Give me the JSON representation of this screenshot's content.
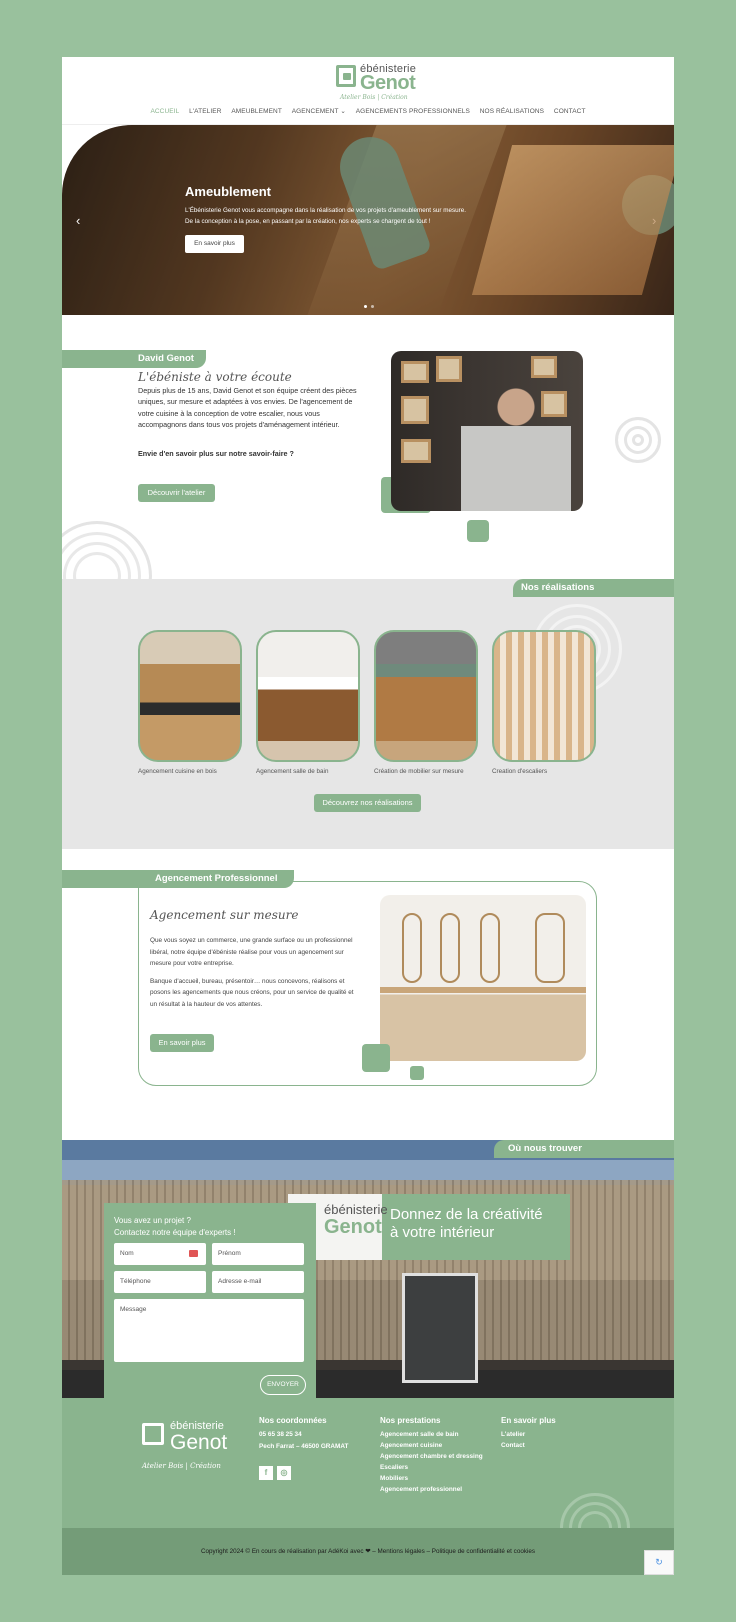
{
  "header": {
    "logo_top": "ébénisterie",
    "logo_main": "Genot",
    "logo_sub": "Atelier Bois | Création",
    "nav": [
      "ACCUEIL",
      "L'ATELIER",
      "AMEUBLEMENT",
      "AGENCEMENT ⌄",
      "AGENCEMENTS PROFESSIONNELS",
      "NOS RÉALISATIONS",
      "CONTACT"
    ]
  },
  "hero": {
    "title": "Ameublement",
    "text_line1": "L'Ébénisterie Genot vous accompagne dans la réalisation de vos projets d'ameublement sur mesure.",
    "text_line2": "De la conception à la pose, en passant par la création, nos experts se chargent de tout !",
    "button": "En savoir plus",
    "arrow_left": "‹",
    "arrow_right": "›"
  },
  "david": {
    "tab": "David Genot",
    "script_title": "L'ébéniste à votre écoute",
    "text": "Depuis plus de 15 ans, David Genot et son équipe créent des pièces uniques, sur mesure et adaptées à vos envies. De l'agencement de votre cuisine à la conception de votre escalier, nous vous accompagnons dans tous vos projets d'aménagement intérieur.",
    "question": "Envie d'en savoir plus sur notre savoir-faire ?",
    "button": "Découvrir l'atelier"
  },
  "realisations": {
    "tab": "Nos réalisations",
    "cards": [
      {
        "caption": "Agencement cuisine en bois"
      },
      {
        "caption": "Agencement salle de bain"
      },
      {
        "caption": "Création de mobilier sur mesure"
      },
      {
        "caption": "Creation d'escaliers"
      }
    ],
    "button": "Découvrez nos réalisations"
  },
  "agencement": {
    "tab": "Agencement Professionnel",
    "script_title": "Agencement sur mesure",
    "para1": "Que vous soyez un commerce, une grande surface ou un professionnel libéral, notre équipe d'ébéniste réalise pour vous un agencement sur mesure pour votre entreprise.",
    "para2": "Banque d'accueil, bureau, présentoir… nous concevons, réalisons et posons les agencements que nous créons, pour un service de qualité et un résultat à la hauteur de vos attentes.",
    "button": "En savoir plus"
  },
  "find": {
    "tab": "Où nous trouver",
    "banner_top": "ébénisterie",
    "banner_main": "Genot",
    "banner_line1": "Donnez de la créativité",
    "banner_line2": "à votre intérieur",
    "form": {
      "title_line1": "Vous avez un projet ?",
      "title_line2": "Contactez notre équipe d'experts !",
      "nom": "Nom",
      "prenom": "Prénom",
      "telephone": "Téléphone",
      "email": "Adresse e-mail",
      "message": "Message",
      "send": "ENVOYER"
    }
  },
  "footer": {
    "logo_top": "ébénisterie",
    "logo_main": "Genot",
    "logo_sub": "Atelier Bois | Création",
    "coords_title": "Nos coordonnées",
    "phone": "05 65 38 25 34",
    "address": "Pech Farrat – 46500 GRAMAT",
    "social": [
      "f",
      "◎"
    ],
    "prestations_title": "Nos prestations",
    "prestations": [
      "Agencement salle de bain",
      "Agencement cuisine",
      "Agencement chambre et dressing",
      "Escaliers",
      "Mobiliers",
      "Agencement professionnel"
    ],
    "more_title": "En savoir plus",
    "more": [
      "L'atelier",
      "Contact"
    ],
    "copyright": "Copyright 2024 © En cours de réalisation par AdéKoi avec ❤ – Mentions légales – Politique de confidentialité et cookies"
  },
  "colors": {
    "accent": "#8ab48e",
    "background": "#99c19d",
    "footer_bottom": "#749c78"
  }
}
